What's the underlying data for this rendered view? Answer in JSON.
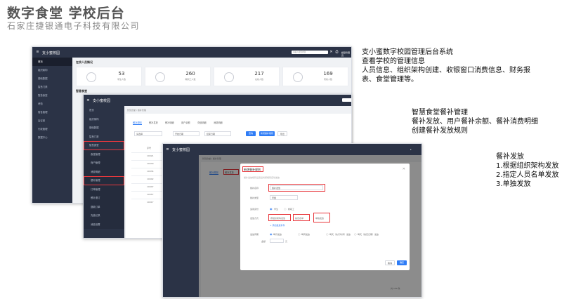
{
  "header": {
    "title": "数字食堂 学校后台",
    "subtitle": "石家庄捷银通电子科技有限公司"
  },
  "screen1": {
    "brand": "支小蜜校园",
    "search_placeholder": "请输入搜索内容",
    "user": "超级管理员",
    "sidebar": [
      "首页",
      "组织架构",
      "基础数据",
      "智慧门禁",
      "智慧食堂",
      "考勤",
      "宿舍管理",
      "会议室",
      "行政管理",
      "数据中心"
    ],
    "section_title": "在校人员情况",
    "cards": [
      {
        "value": "53",
        "label": "学生人数"
      },
      {
        "value": "260",
        "label": "教职工人数"
      },
      {
        "value": "217",
        "label": "在校人数"
      },
      {
        "value": "169",
        "label": "离校人数"
      }
    ],
    "section2": "智慧食堂"
  },
  "screen2": {
    "brand": "支小蜜校园",
    "breadcrumb": "智慧食堂 / 餐补管理",
    "sidebar": [
      "首页",
      "组织架构",
      "基础数据",
      "智慧门禁",
      "智慧食堂",
      "食堂管理",
      "商户管理",
      "消费明细",
      "餐补管理",
      "订单管理",
      "餐补退订",
      "退款订单",
      "充值记录",
      "消费设置"
    ],
    "tabs": [
      "餐补规则",
      "餐补发放",
      "餐补明细",
      "用户余额",
      "充值明细",
      "消费明细"
    ],
    "filter_select": "请选择",
    "date_start": "开始日期",
    "date_end": "结束日期",
    "search_btn": "查询",
    "new_btn": "新增餐补规则",
    "export_btn": "导出",
    "table_header": "序号",
    "rows": [
      "10021",
      "10030",
      "10034",
      "10042",
      "10047",
      "10057",
      "10017"
    ]
  },
  "screen3": {
    "brand": "支小蜜校园",
    "breadcrumb": "智慧食堂 / 餐补管理",
    "tabs": [
      "餐补规则",
      "餐补发放"
    ],
    "modal": {
      "title": "新增餐补规则",
      "hint": "餐补发放规则设置后将按规则自动发放",
      "fields": [
        {
          "label": "餐补名称",
          "value": "餐补发放"
        },
        {
          "label": "餐补类型",
          "value": "早餐"
        },
        {
          "label": "适用身份",
          "value": "学生"
        },
        {
          "label": "发放方式",
          "value": "按组织架构发放"
        },
        {
          "label": "发放周期",
          "value": "每月发放"
        }
      ],
      "identity_option2": "教职工",
      "method_option2": "指定名单",
      "method_option3": "单独发放",
      "add_link": "+ 添加发放条件",
      "cycle_options": [
        "每月发放",
        "每周发放",
        "每天（执行时间）发放",
        "每天（指定日期）发放"
      ],
      "amount_label": "金额",
      "amount_unit": "元",
      "cancel": "取消",
      "confirm": "确定"
    },
    "pagination": "共 150 条"
  },
  "descriptions": {
    "block1": [
      "支小蜜数字校园管理后台系统",
      "查看学校的管理信息",
      "人员信息、组织架构创建、收银窗口消费信息、财务报",
      "表、食堂管理等。"
    ],
    "block2": [
      "智慧食堂餐补管理",
      "餐补发放、用户餐补余额、餐补消费明细",
      "创建餐补发放规则"
    ],
    "block3": [
      "餐补发放",
      "1.根据组织架构发放",
      "2.指定人员名单发放",
      "3.单独发放"
    ]
  }
}
